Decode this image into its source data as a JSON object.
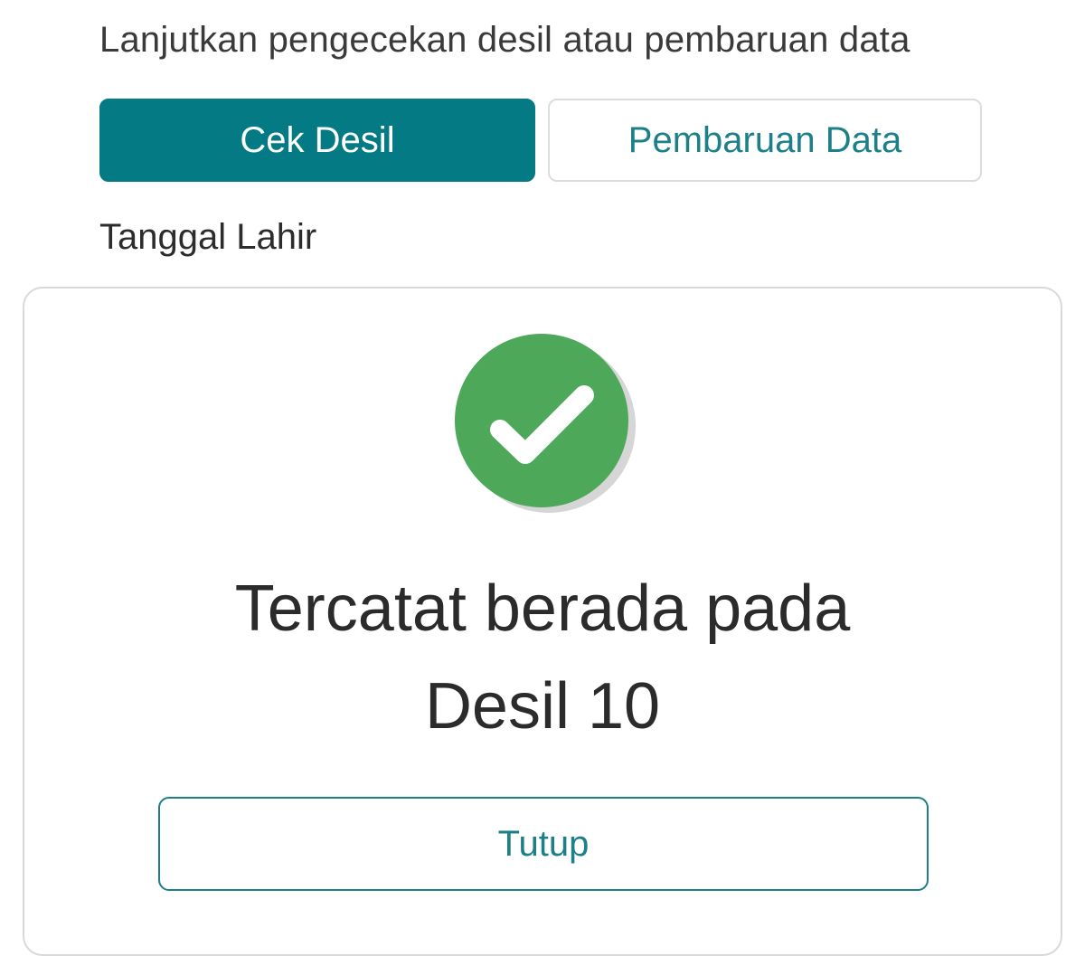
{
  "instruction": "Lanjutkan pengecekan desil atau pembaruan data",
  "tabs": {
    "cek_desil": "Cek Desil",
    "pembaruan_data": "Pembaruan Data"
  },
  "form": {
    "date_of_birth_label": "Tanggal Lahir"
  },
  "result_modal": {
    "icon": "check-circle-icon",
    "line1": "Tercatat berada pada",
    "line2": "Desil 10",
    "close_label": "Tutup"
  },
  "colors": {
    "primary": "#037a84",
    "accent_text": "#1d8088",
    "success": "#4da85a"
  }
}
